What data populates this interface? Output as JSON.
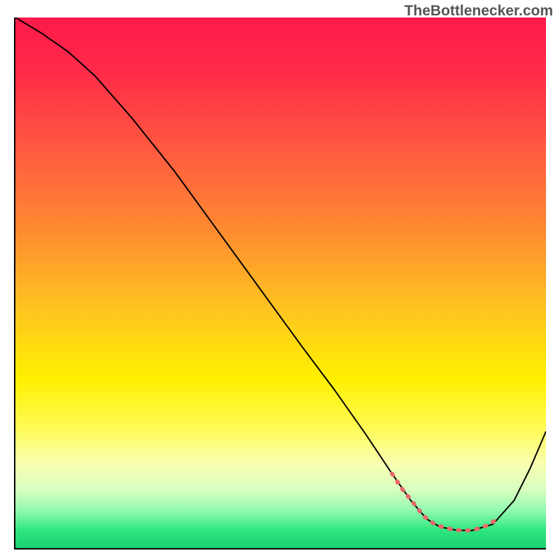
{
  "watermark": "TheBottlenecker.com",
  "chart_data": {
    "type": "line",
    "title": "",
    "xlabel": "",
    "ylabel": "",
    "xlim": [
      0,
      100
    ],
    "ylim": [
      0,
      100
    ],
    "gradient_stops": [
      {
        "offset": 0,
        "color": "#ff1a4a"
      },
      {
        "offset": 10,
        "color": "#ff2a48"
      },
      {
        "offset": 25,
        "color": "#ff5a40"
      },
      {
        "offset": 40,
        "color": "#ff8a30"
      },
      {
        "offset": 55,
        "color": "#ffc420"
      },
      {
        "offset": 68,
        "color": "#fff000"
      },
      {
        "offset": 77,
        "color": "#fffb50"
      },
      {
        "offset": 84,
        "color": "#f8ffb0"
      },
      {
        "offset": 89,
        "color": "#d8ffc0"
      },
      {
        "offset": 93,
        "color": "#90f9b0"
      },
      {
        "offset": 96.5,
        "color": "#30e880"
      },
      {
        "offset": 100,
        "color": "#18d070"
      }
    ],
    "series": [
      {
        "name": "curve",
        "stroke": "#000000",
        "x": [
          0,
          5,
          10,
          15,
          22,
          30,
          38,
          46,
          54,
          60,
          66,
          71,
          74.5,
          77.5,
          80,
          83,
          86,
          90,
          94,
          97,
          100
        ],
        "y": [
          100,
          97,
          93.5,
          89,
          81,
          71,
          60,
          49,
          38,
          30,
          21.5,
          14,
          9,
          5.5,
          4,
          3.4,
          3.3,
          4.5,
          9,
          15,
          22
        ]
      },
      {
        "name": "highlight",
        "stroke": "#e86a6a",
        "dashed": true,
        "x": [
          71,
          73,
          75,
          77,
          79,
          81,
          83,
          85,
          87,
          89,
          91
        ],
        "y": [
          14,
          11,
          8.5,
          6,
          4.5,
          3.8,
          3.4,
          3.3,
          3.6,
          4.3,
          5.6
        ]
      }
    ]
  }
}
